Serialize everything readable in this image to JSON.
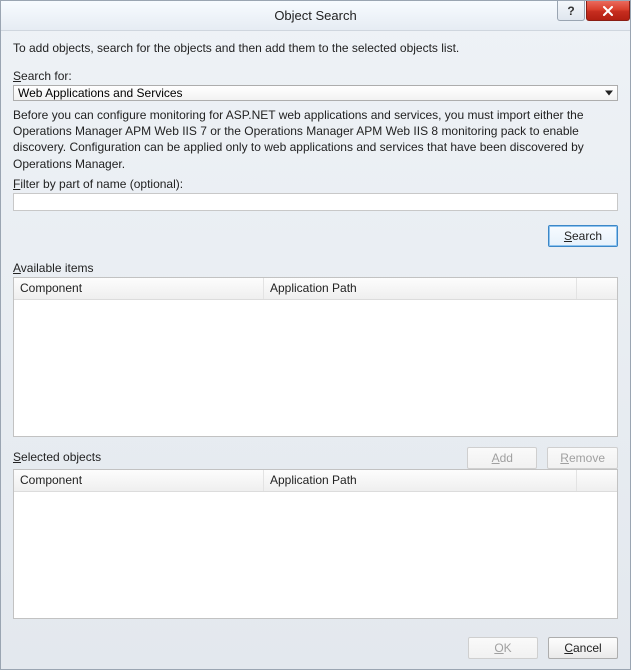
{
  "window": {
    "title": "Object Search",
    "help_label": "?",
    "close_label": "x"
  },
  "instructions": "To add objects, search for the objects and then add them to the selected objects list.",
  "search_for": {
    "label_pre": "S",
    "label_post": "earch for:",
    "selected": "Web Applications and Services"
  },
  "description": "Before you can configure monitoring for ASP.NET web applications and services, you must import either the Operations Manager APM Web IIS 7 or the Operations Manager APM Web IIS 8 monitoring pack to enable discovery. Configuration can be applied only to web applications and services that have been discovered by Operations Manager.",
  "filter": {
    "label_pre": "F",
    "label_post": "ilter by part of name (optional):",
    "value": ""
  },
  "search_button": {
    "pre": "S",
    "post": "earch"
  },
  "available": {
    "label_pre": "A",
    "label_post": "vailable items",
    "columns": {
      "component": "Component",
      "path": "Application Path"
    },
    "rows": []
  },
  "add_button": {
    "pre": "A",
    "post": "dd"
  },
  "remove_button": {
    "pre": "R",
    "post": "emove"
  },
  "selected": {
    "label_pre": "S",
    "label_post": "elected objects",
    "columns": {
      "component": "Component",
      "path": "Application Path"
    },
    "rows": []
  },
  "ok_button": {
    "pre": "O",
    "post": "K"
  },
  "cancel_button": {
    "pre": "C",
    "post": "ancel"
  }
}
